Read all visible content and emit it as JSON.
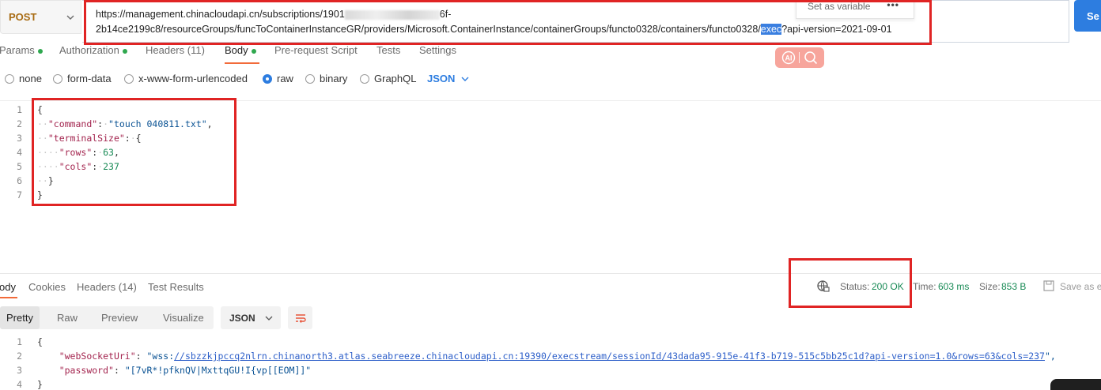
{
  "request": {
    "method": "POST",
    "url_line1_a": "https://management.chinacloudapi.cn/subscriptions/1901",
    "url_line1_b": "6f-",
    "url_line2_a": "2b14ce2199c8/resourceGroups/funcToContainerInstanceGR/providers/Microsoft.ContainerInstance/containerGroups/functo0328/containers/functo0328/",
    "url_highlight": "exec",
    "url_line2_b": "?api-version=2021-09-01",
    "popup_label": "Set as variable",
    "popup_more": "•••",
    "send_label": "Se"
  },
  "request_tabs": [
    {
      "label": "Params",
      "dot": true
    },
    {
      "label": "Authorization",
      "dot": true
    },
    {
      "label": "Headers (11)",
      "dot": false
    },
    {
      "label": "Body",
      "dot": true
    },
    {
      "label": "Pre-request Script",
      "dot": false
    },
    {
      "label": "Tests",
      "dot": false
    },
    {
      "label": "Settings",
      "dot": false
    }
  ],
  "body_types": [
    {
      "label": "none",
      "selected": false
    },
    {
      "label": "form-data",
      "selected": false
    },
    {
      "label": "x-www-form-urlencoded",
      "selected": false
    },
    {
      "label": "raw",
      "selected": true
    },
    {
      "label": "binary",
      "selected": false
    },
    {
      "label": "GraphQL",
      "selected": false
    }
  ],
  "body_language": "JSON",
  "request_body": {
    "line_numbers": [
      "1",
      "2",
      "3",
      "4",
      "5",
      "6",
      "7"
    ],
    "command_key": "\"command\"",
    "command_value": "\"touch 040811.txt\"",
    "terminal_key": "\"terminalSize\"",
    "rows_key": "\"rows\"",
    "rows_value": "63",
    "cols_key": "\"cols\"",
    "cols_value": "237"
  },
  "response_tabs": [
    {
      "label": "ody"
    },
    {
      "label": "Cookies"
    },
    {
      "label": "Headers (14)"
    },
    {
      "label": "Test Results"
    }
  ],
  "response_status": {
    "status_label": "Status:",
    "status_value": "200 OK",
    "time_label": "Time:",
    "time_value": "603 ms",
    "size_label": "Size:",
    "size_value": "853 B",
    "save_label": "Save as e"
  },
  "response_formats": [
    "Pretty",
    "Raw",
    "Preview",
    "Visualize"
  ],
  "response_language": "JSON",
  "response_body": {
    "line_numbers": [
      "1",
      "2",
      "3",
      "4"
    ],
    "websocket_key": "\"webSocketUri\"",
    "websocket_prefix": "\"wss:",
    "websocket_link": "//sbzzkjpccq2nlrn.chinanorth3.atlas.seabreeze.chinacloudapi.cn:19390/execstream/sessionId/43dada95-915e-41f3-b719-515c5bb25c1d?api-version=1.0&rows=63&cols=237",
    "websocket_suffix": "\",",
    "password_key": "\"password\"",
    "password_value": "\"[7vR*!pfknQV|MxttqGU!I{vp[[EOM]]\""
  },
  "colors": {
    "accent_orange": "#f26b3a",
    "brand_blue": "#2d7de0",
    "status_green": "#188a55",
    "annotation_red": "#e02424"
  }
}
